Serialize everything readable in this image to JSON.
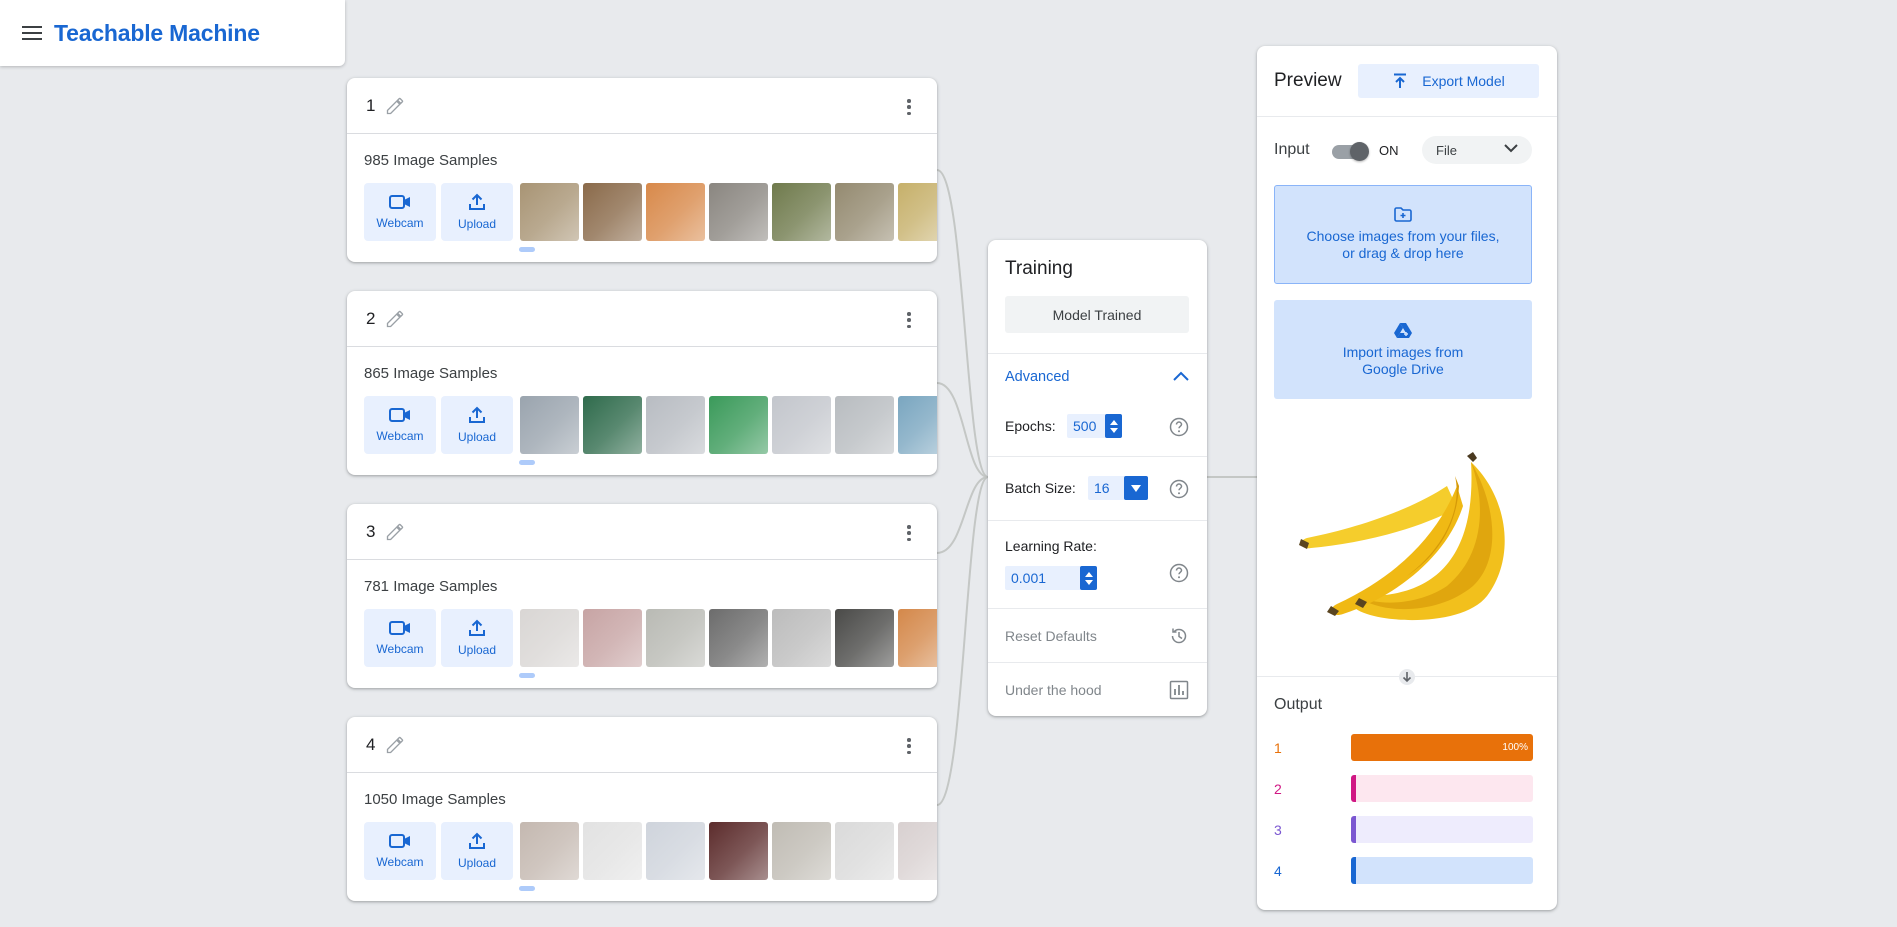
{
  "header": {
    "title": "Teachable Machine"
  },
  "classes": [
    {
      "name": "1",
      "sample_count": "985 Image Samples",
      "webcam_label": "Webcam",
      "upload_label": "Upload",
      "thumb_colors": [
        "#a89474",
        "#8a6a4a",
        "#d8894a",
        "#8a8680",
        "#6f7a4c",
        "#948a70",
        "#c6b06a"
      ]
    },
    {
      "name": "2",
      "sample_count": "865 Image Samples",
      "webcam_label": "Webcam",
      "upload_label": "Upload",
      "thumb_colors": [
        "#9aa4ae",
        "#2f6b4c",
        "#b8bcc2",
        "#3a9a5a",
        "#c3c6cc",
        "#b8bcc0",
        "#7aa6c0"
      ]
    },
    {
      "name": "3",
      "sample_count": "781 Image Samples",
      "webcam_label": "Webcam",
      "upload_label": "Upload",
      "thumb_colors": [
        "#d9d6d4",
        "#c7a4a4",
        "#b9bab4",
        "#6c6c6c",
        "#bcbcbc",
        "#4a4a48",
        "#d4884a"
      ]
    },
    {
      "name": "4",
      "sample_count": "1050 Image Samples",
      "webcam_label": "Webcam",
      "upload_label": "Upload",
      "thumb_colors": [
        "#c4b8b0",
        "#e2e2e2",
        "#cfd4dc",
        "#5c2c2c",
        "#c0bcb4",
        "#dadada",
        "#d8d0d0"
      ]
    }
  ],
  "training": {
    "title": "Training",
    "trained_label": "Model Trained",
    "advanced_label": "Advanced",
    "epochs_label": "Epochs:",
    "epochs_value": "500",
    "batch_label": "Batch Size:",
    "batch_value": "16",
    "lr_label": "Learning Rate:",
    "lr_value": "0.001",
    "reset_label": "Reset Defaults",
    "hood_label": "Under the hood"
  },
  "preview": {
    "title": "Preview",
    "export_label": "Export Model",
    "input_label": "Input",
    "toggle_state": "ON",
    "source_select": "File",
    "drop_text_1": "Choose images from your files,",
    "drop_text_2": "or drag & drop here",
    "drive_text_1": "Import images from",
    "drive_text_2": "Google Drive",
    "output_label": "Output",
    "outputs": [
      {
        "label": "1",
        "percent": 100,
        "percent_text": "100%",
        "color": "#e8710a",
        "bg": "#feefe3"
      },
      {
        "label": "2",
        "percent": 0,
        "percent_text": "",
        "color": "#d01884",
        "bg": "#fde7ef"
      },
      {
        "label": "3",
        "percent": 0,
        "percent_text": "",
        "color": "#7b57d1",
        "bg": "#eeecfd"
      },
      {
        "label": "4",
        "percent": 0,
        "percent_text": "",
        "color": "#1967d2",
        "bg": "#d2e3fc"
      }
    ]
  },
  "colors": {
    "accent": "#1967d2",
    "accent_light": "#e8f0fe",
    "background": "#e8eaed"
  }
}
